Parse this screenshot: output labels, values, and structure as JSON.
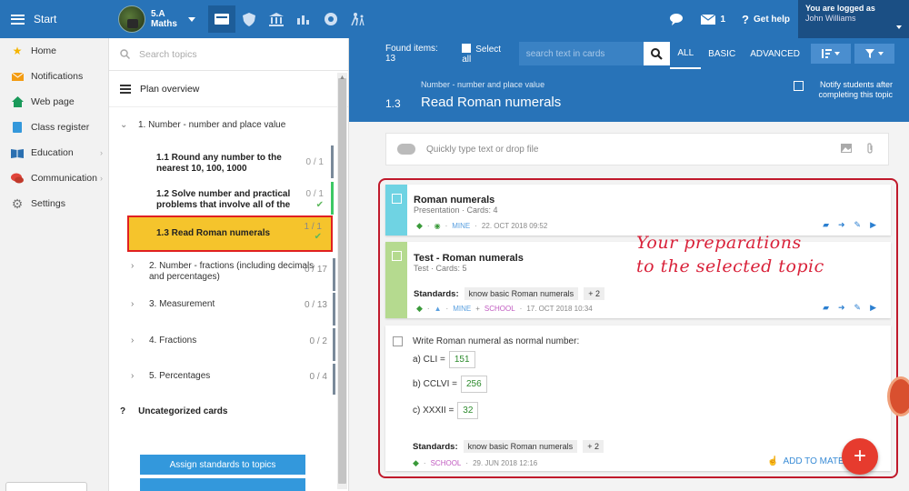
{
  "topbar": {
    "start_label": "Start",
    "class_code": "5.A",
    "class_subject": "Maths",
    "messages_count": "1",
    "help_label": "Get help",
    "logged_as": "You are logged as",
    "user_name": "John Williams",
    "icons": [
      "board-icon",
      "shield-icon",
      "bank-icon",
      "bar-chart-icon",
      "sun-icon",
      "walking-icon"
    ]
  },
  "nav": {
    "items": [
      {
        "label": "Home",
        "icon": "star-icon"
      },
      {
        "label": "Notifications",
        "icon": "mail-icon"
      },
      {
        "label": "Web page",
        "icon": "house-icon"
      },
      {
        "label": "Class register",
        "icon": "book-icon"
      },
      {
        "label": "Education",
        "icon": "open-book-icon"
      },
      {
        "label": "Communication",
        "icon": "chat-icon"
      },
      {
        "label": "Settings",
        "icon": "gear-icon"
      }
    ]
  },
  "topics": {
    "search_placeholder": "Search topics",
    "plan_label": "Plan overview",
    "group1": {
      "label": "1. Number - number and place value"
    },
    "sub": [
      {
        "label": "1.1 Round any number to the nearest 10, 100, 1000",
        "count": "0 / 1"
      },
      {
        "label": "1.2 Solve number and practical problems that involve all of the",
        "count": "0 / 1"
      },
      {
        "label": "1.3 Read Roman numerals",
        "count": "1 / 1"
      }
    ],
    "groups": [
      {
        "label": "2. Number - fractions (including decimals and percentages)",
        "count": "0 / 17"
      },
      {
        "label": "3. Measurement",
        "count": "0 / 13"
      },
      {
        "label": "4. Fractions",
        "count": "0 / 2"
      },
      {
        "label": "5. Percentages",
        "count": "0 / 4"
      }
    ],
    "uncategorized": "Uncategorized cards",
    "assign_label": "Assign standards to topics"
  },
  "filterbar": {
    "found": "Found items: 13",
    "select_all": "Select all",
    "search_placeholder": "search text in cards",
    "tabs": [
      "ALL",
      "BASIC",
      "ADVANCED"
    ]
  },
  "header": {
    "subtitle": "Number - number and place value",
    "number": "1.3",
    "title": "Read Roman numerals",
    "notify": "Notify students after completing this topic"
  },
  "drop_placeholder": "Quickly type text or drop file",
  "cards": [
    {
      "title": "Roman numerals",
      "meta": "Presentation · Cards: 4",
      "owner": "MINE",
      "date": "22. OCT 2018 09:52",
      "color": "#6fd3e3"
    },
    {
      "title": "Test - Roman numerals",
      "meta": "Test · Cards: 5",
      "owner": "MINE",
      "owner2": "SCHOOL",
      "date": "17. OCT 2018 10:34",
      "color": "#b5da8f",
      "standards_label": "Standards:",
      "standard": "know basic Roman numerals",
      "more": "+ 2"
    }
  ],
  "question_card": {
    "prompt": "Write Roman numeral as normal number:",
    "items": [
      {
        "label": "a) CLI =",
        "answer": "151"
      },
      {
        "label": "b) CCLVI =",
        "answer": "256"
      },
      {
        "label": "c) XXXII =",
        "answer": "32"
      }
    ],
    "standards_label": "Standards:",
    "standard": "know basic Roman numerals",
    "more": "+ 2",
    "owner": "SCHOOL",
    "date": "29. JUN 2018 12:16",
    "add_label": "ADD TO MATE"
  },
  "annotation": {
    "line1": "Your preparations",
    "line2": "to the selected topic"
  },
  "fab_label": "+"
}
